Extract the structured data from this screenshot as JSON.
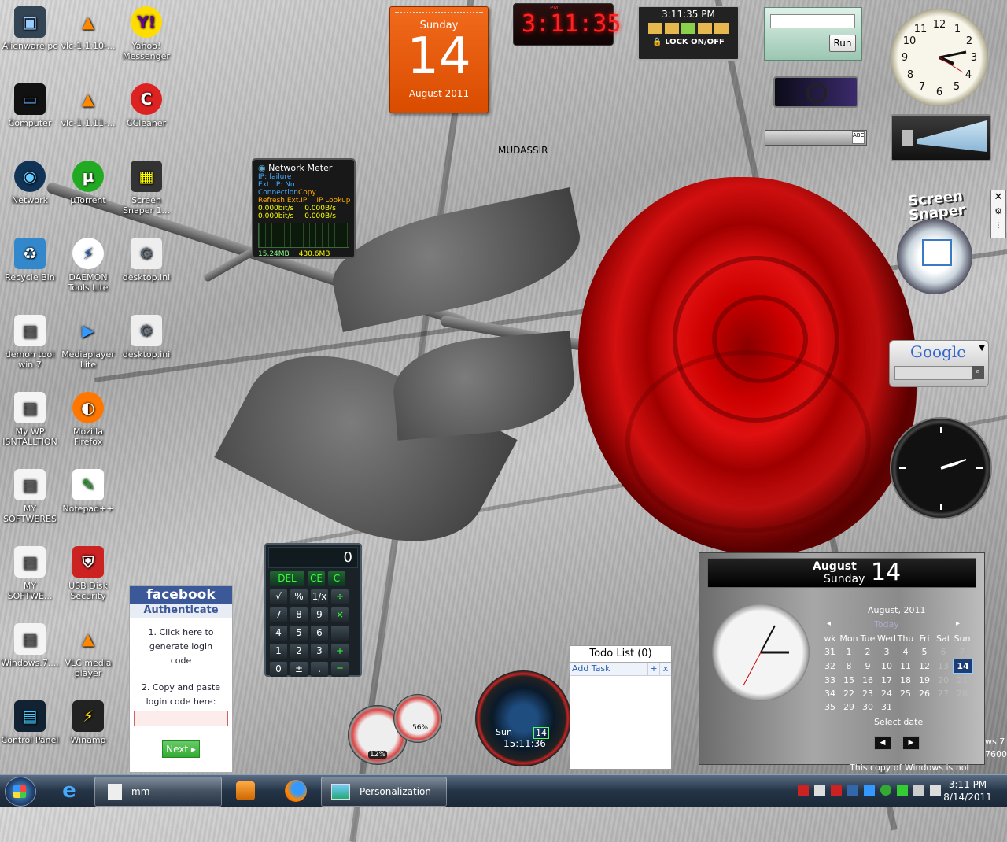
{
  "desktop_label": "MUDASSIR",
  "icons": [
    {
      "label": "Alienware pc",
      "name": "alienware-pc-icon"
    },
    {
      "label": "vlc-1.1.10-...",
      "name": "vlc-icon"
    },
    {
      "label": "Yahoo! Messenger",
      "name": "yahoo-messenger-icon"
    },
    {
      "label": "Computer",
      "name": "computer-icon"
    },
    {
      "label": "vlc-1.1.11-...",
      "name": "vlc-icon"
    },
    {
      "label": "CCleaner",
      "name": "ccleaner-icon"
    },
    {
      "label": "Network",
      "name": "network-icon"
    },
    {
      "label": "µTorrent",
      "name": "utorrent-icon"
    },
    {
      "label": "Screen Snaper 1...",
      "name": "screen-snaper-icon"
    },
    {
      "label": "Recycle Bin",
      "name": "recycle-bin-icon"
    },
    {
      "label": "DAEMON Tools Lite",
      "name": "daemon-tools-icon"
    },
    {
      "label": "desktop.ini",
      "name": "ini-file-icon"
    },
    {
      "label": "demon tool win 7",
      "name": "shortcut-icon"
    },
    {
      "label": "Mediaplayer Lite",
      "name": "mediaplayer-icon"
    },
    {
      "label": "desktop.ini",
      "name": "ini-file-icon"
    },
    {
      "label": "My WP ISNTALLTION",
      "name": "shortcut-icon"
    },
    {
      "label": "Mozilla Firefox",
      "name": "firefox-icon"
    },
    {
      "label": "MY SOFTWERES",
      "name": "shortcut-icon"
    },
    {
      "label": "Notepad++",
      "name": "notepad-plus-icon"
    },
    {
      "label": "MY SOFTWE...",
      "name": "shortcut-icon"
    },
    {
      "label": "USB Disk Security",
      "name": "usb-disk-security-icon"
    },
    {
      "label": "Windows.7....",
      "name": "shortcut-icon"
    },
    {
      "label": "VLC media player",
      "name": "vlc-icon"
    },
    {
      "label": "Control Panel",
      "name": "control-panel-icon"
    },
    {
      "label": "Winamp",
      "name": "winamp-icon"
    }
  ],
  "calendar_gadget": {
    "day_name": "Sunday",
    "day": "14",
    "month_year": "August 2011"
  },
  "digital_clock": {
    "ampm": "PM",
    "time": "3:11:35"
  },
  "lock_gadget": {
    "time": "3:11:35 PM",
    "lock_label": "LOCK ON/OFF"
  },
  "run_gadget": {
    "button": "Run"
  },
  "network_meter": {
    "title": "Network Meter",
    "ip": "IP: failure",
    "ext_ip": "Ext. IP: No Connection",
    "copy": "Copy",
    "refresh": "Refresh Ext.IP",
    "lookup": "IP Lookup",
    "up_bits": "0.000bit/s",
    "up_bytes": "0.000B/s",
    "down_bits": "0.000bit/s",
    "down_bytes": "0.000B/s",
    "total_up": "15.24MB",
    "total_down": "430.6MB"
  },
  "screen_snaper": {
    "title_line1": "Screen",
    "title_line2": "Snaper"
  },
  "google": {
    "logo": "Google"
  },
  "calculator": {
    "display": "0",
    "rows": [
      [
        "DEL",
        "CE",
        "C"
      ],
      [
        "√",
        "%",
        "1/x",
        "÷"
      ],
      [
        "7",
        "8",
        "9",
        "×"
      ],
      [
        "4",
        "5",
        "6",
        "-"
      ],
      [
        "1",
        "2",
        "3",
        "+"
      ],
      [
        "0",
        "±",
        ".",
        "="
      ]
    ]
  },
  "facebook": {
    "brand": "facebook",
    "subtitle": "Authenticate",
    "step1": "1. Click here to generate login code",
    "step2": "2. Copy and paste login code here:",
    "next": "Next"
  },
  "gauges": {
    "cpu": "12%",
    "ram": "56%"
  },
  "orb_clock": {
    "day": "Sun",
    "date": "14",
    "time": "15:11:36"
  },
  "todo": {
    "title": "Todo List (0)",
    "add_task": "Add Task",
    "plus": "+",
    "close": "x"
  },
  "date_widget": {
    "month": "August",
    "day_name": "Sunday",
    "day": "14",
    "cal_title": "August, 2011",
    "today": "Today",
    "headers": [
      "wk",
      "Mon",
      "Tue",
      "Wed",
      "Thu",
      "Fri",
      "Sat",
      "Sun"
    ],
    "rows": [
      [
        "31",
        "1",
        "2",
        "3",
        "4",
        "5",
        "6",
        "7"
      ],
      [
        "32",
        "8",
        "9",
        "10",
        "11",
        "12",
        "13",
        "14"
      ],
      [
        "33",
        "15",
        "16",
        "17",
        "18",
        "19",
        "20",
        "21"
      ],
      [
        "34",
        "22",
        "23",
        "24",
        "25",
        "26",
        "27",
        "28"
      ],
      [
        "35",
        "29",
        "30",
        "31",
        "",
        "",
        "",
        ""
      ]
    ],
    "select_date": "Select date"
  },
  "watermark": {
    "line1": "ws 7",
    "line2": "7600",
    "line3": "This copy of Windows is not genuine"
  },
  "taskbar": {
    "items": [
      {
        "label": "mm"
      },
      {
        "label": "Personalization"
      }
    ],
    "clock_time": "3:11 PM",
    "clock_date": "8/14/2011"
  }
}
